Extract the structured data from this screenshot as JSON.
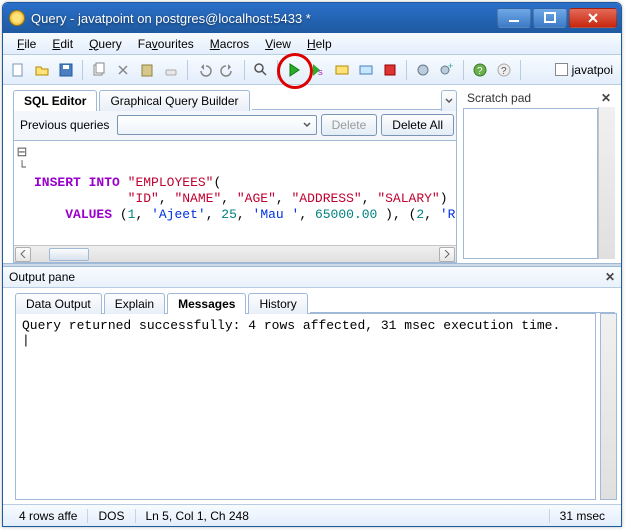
{
  "window": {
    "title": "Query - javatpoint on postgres@localhost:5433 *"
  },
  "menu": {
    "file": "File",
    "edit": "Edit",
    "query": "Query",
    "favourites": "Favourites",
    "macros": "Macros",
    "view": "View",
    "help": "Help"
  },
  "toolbar_tail": {
    "checkbox_label": "javatpoi"
  },
  "tabs": {
    "sql_editor": "SQL Editor",
    "gqb": "Graphical Query Builder"
  },
  "prev_queries": {
    "label": "Previous queries",
    "delete": "Delete",
    "delete_all": "Delete All"
  },
  "sql": {
    "line1a": "INSERT",
    "line1b": "INTO",
    "line1c": "\"EMPLOYEES\"",
    "line1d": "(",
    "line2a": "\"ID\"",
    "line2b": "\"NAME\"",
    "line2c": "\"AGE\"",
    "line2d": "\"ADDRESS\"",
    "line2e": "\"SALARY\"",
    "line2f": ")",
    "line3a": "VALUES",
    "line3b": "(",
    "line3c": "1",
    "line3d": "'Ajeet'",
    "line3e": "25",
    "line3f": "'Mau '",
    "line3g": "65000.00",
    "line3h": "), (",
    "line3i": "2",
    "line3j": "'Rak"
  },
  "scratch": {
    "title": "Scratch pad"
  },
  "output": {
    "pane_title": "Output pane",
    "tabs": {
      "data": "Data Output",
      "explain": "Explain",
      "messages": "Messages",
      "history": "History"
    },
    "message": "Query returned successfully: 4 rows affected, 31 msec execution time.",
    "caret": "|"
  },
  "status": {
    "rows": "4 rows affe",
    "mode": "DOS",
    "pos": "Ln 5, Col 1, Ch 248",
    "time": "31 msec"
  }
}
